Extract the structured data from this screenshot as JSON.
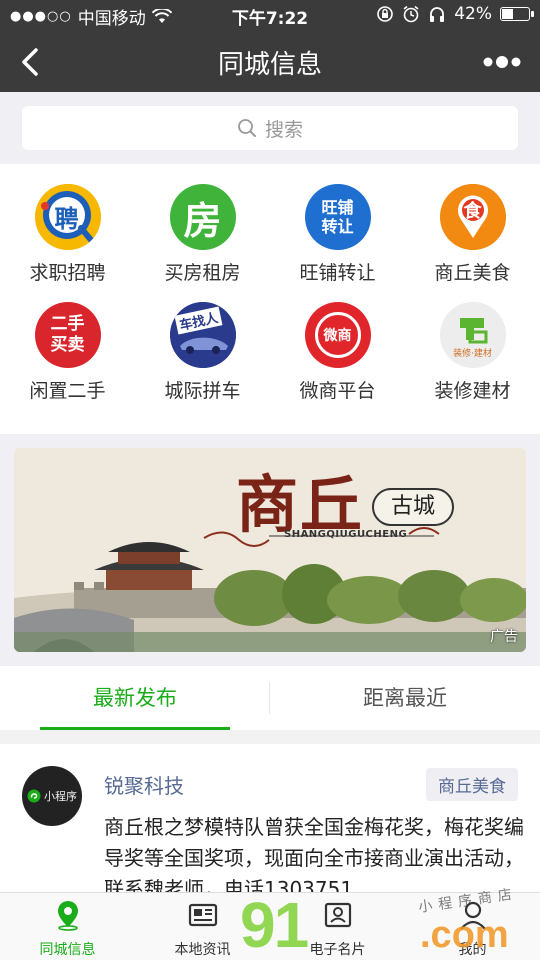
{
  "status_bar": {
    "carrier": "中国移动",
    "time": "下午7:22",
    "battery_percent": "42%",
    "battery_level": 0.42
  },
  "nav": {
    "title": "同城信息"
  },
  "search": {
    "placeholder": "搜索"
  },
  "categories": [
    {
      "label": "求职招聘",
      "glyph": "聘"
    },
    {
      "label": "买房租房",
      "glyph": "房"
    },
    {
      "label": "旺铺转让",
      "glyph": "旺铺\n转让"
    },
    {
      "label": "商丘美食",
      "glyph": "食"
    },
    {
      "label": "闲置二手",
      "glyph": "二手\n买卖"
    },
    {
      "label": "城际拼车",
      "glyph": "车找人"
    },
    {
      "label": "微商平台",
      "glyph": "微商"
    },
    {
      "label": "装修建材",
      "glyph": "装修·建材"
    }
  ],
  "banner": {
    "title": "商丘",
    "seal_text": "古城",
    "pinyin": "SHANGQIUGUCHENG",
    "ad_label": "广告"
  },
  "tabs": {
    "latest": "最新发布",
    "nearest": "距离最近"
  },
  "post": {
    "avatar_text": "小程序",
    "author": "锐聚科技",
    "category": "商丘美食",
    "body": "商丘根之梦模特队曾获全国金梅花奖，梅花奖编导奖等全国奖项，现面向全市接商业演出活动，联系魏老师，电话1303751"
  },
  "tabbar": {
    "items": [
      {
        "label": "同城信息"
      },
      {
        "label": "本地资讯"
      },
      {
        "label": "电子名片"
      },
      {
        "label": "我的"
      }
    ]
  },
  "watermark": {
    "number": "91",
    "domain": ".com",
    "shop": "小程序商店"
  },
  "colors": {
    "accent": "#1aad19",
    "nav_bg": "#3b3b3b",
    "link": "#576b95"
  }
}
